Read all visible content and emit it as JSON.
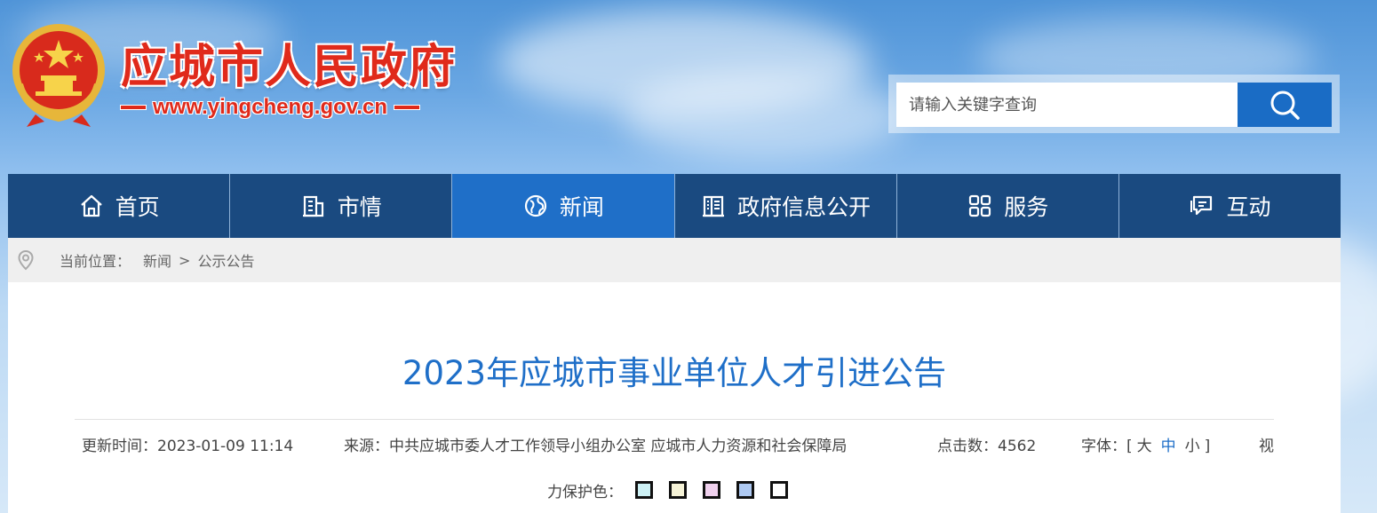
{
  "header": {
    "site_title": "应城市人民政府",
    "site_url": "www.yingcheng.gov.cn"
  },
  "search": {
    "placeholder": "请输入关键字查询",
    "button_icon": "search-icon"
  },
  "nav": {
    "items": [
      {
        "label": "首页",
        "icon": "home-icon"
      },
      {
        "label": "市情",
        "icon": "building-icon"
      },
      {
        "label": "新闻",
        "icon": "globe-icon",
        "active": true
      },
      {
        "label": "政府信息公开",
        "icon": "book-icon"
      },
      {
        "label": "服务",
        "icon": "grid-icon"
      },
      {
        "label": "互动",
        "icon": "chat-icon"
      }
    ]
  },
  "breadcrumb": {
    "label": "当前位置：",
    "items": [
      "新闻",
      "公示公告"
    ],
    "separator": ">"
  },
  "article": {
    "title": "2023年应城市事业单位人才引进公告",
    "meta": {
      "update_time": "更新时间：2023-01-09 11:14",
      "source": "来源：中共应城市委人才工作领导小组办公室 应城市人力资源和社会保障局",
      "clicks_label": "点击数：",
      "clicks": "4562",
      "font_label": "字体：[",
      "font_large": "大",
      "font_medium": "中",
      "font_small": "小",
      "font_close": "]",
      "vision_prefix": "视"
    },
    "eye_protection": {
      "label": "力保护色：",
      "colors": [
        "#cdf1f5",
        "#f6f3d7",
        "#f0d1ee",
        "#aec9f2",
        "#ffffff"
      ]
    }
  },
  "colors": {
    "nav_bg": "#1a4a80",
    "nav_active": "#1f6fc8",
    "title_blue": "#1f6fc8",
    "brand_red": "#e02a1b"
  }
}
